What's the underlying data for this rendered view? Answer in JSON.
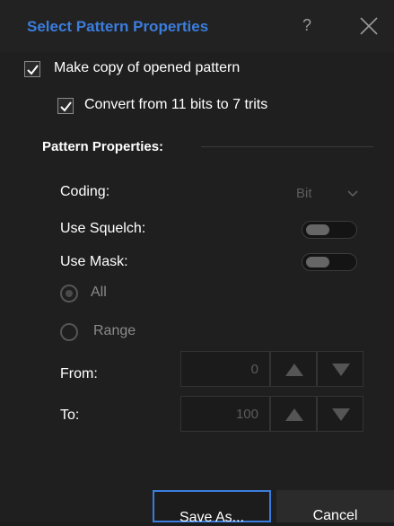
{
  "dialog": {
    "title": "Select Pattern Properties",
    "help_label": "?",
    "title_color": "#3b7ddd"
  },
  "options": {
    "make_copy": {
      "label": "Make copy of opened pattern",
      "checked": true
    },
    "convert": {
      "label": "Convert from 11 bits to 7 trits",
      "checked": true
    }
  },
  "pattern_properties": {
    "section_label": "Pattern Properties:",
    "coding": {
      "label": "Coding:",
      "value": "Bit"
    },
    "use_squelch": {
      "label": "Use Squelch:",
      "on": false
    },
    "use_mask": {
      "label": "Use Mask:",
      "on": false
    },
    "range_mode": {
      "all_label": "All",
      "range_label": "Range",
      "selected": "All"
    },
    "from": {
      "label": "From:",
      "value": "0"
    },
    "to": {
      "label": "To:",
      "value": "100"
    }
  },
  "buttons": {
    "save_as": "Save As...",
    "cancel": "Cancel"
  },
  "icons": {
    "close": "close-icon",
    "check": "checkmark-icon",
    "chevron": "chevron-down-icon",
    "up": "triangle-up-icon",
    "down": "triangle-down-icon"
  }
}
